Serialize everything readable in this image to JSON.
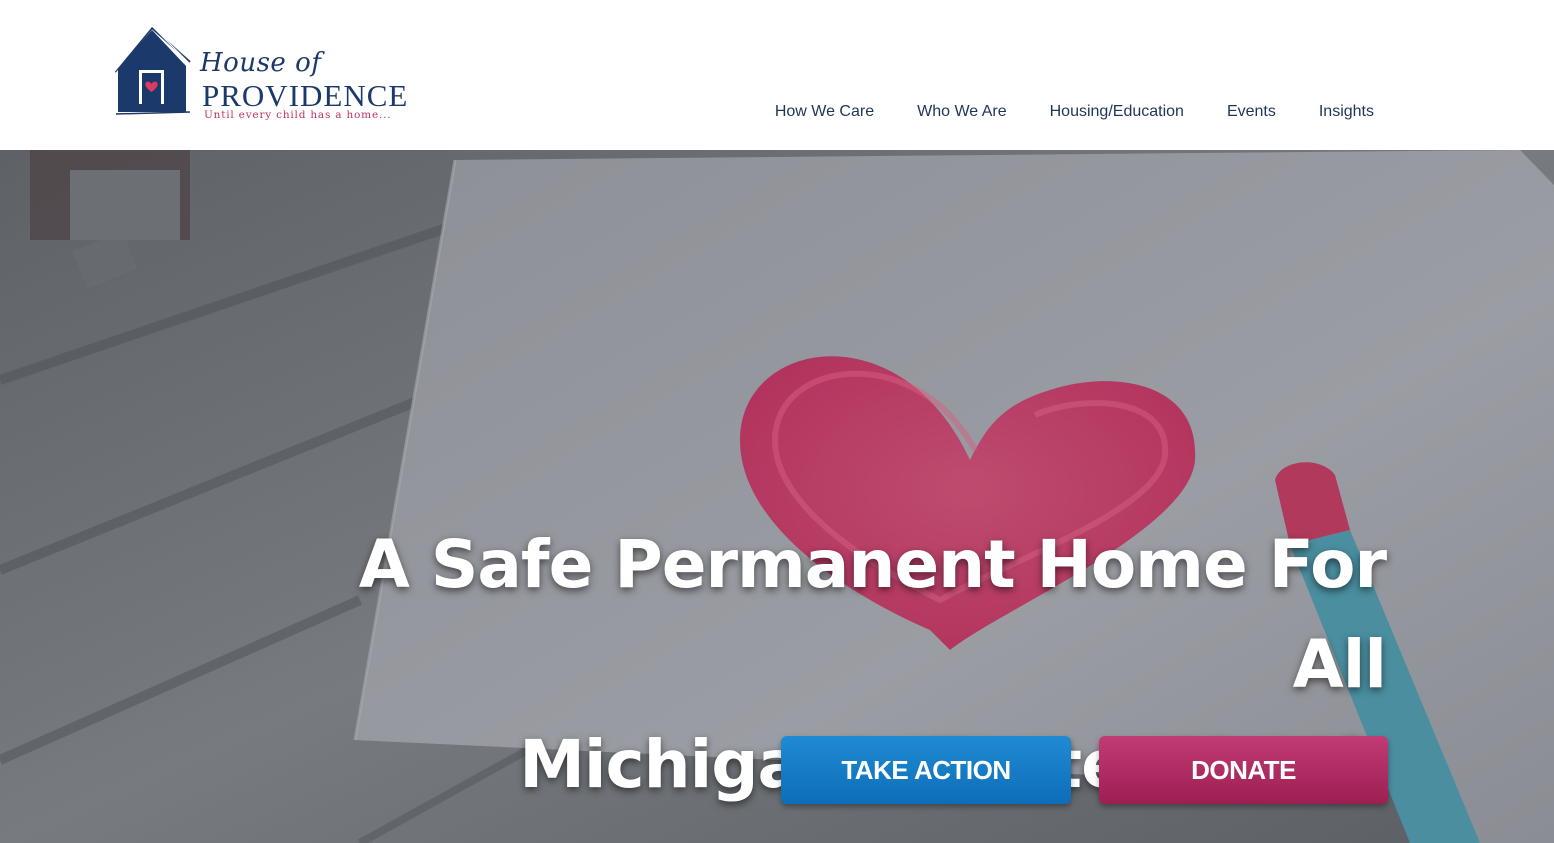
{
  "brand": {
    "script_text": "House of",
    "name": "PROVIDENCE",
    "tagline": "Until every child has a home...",
    "colors": {
      "navy": "#1b3a6b",
      "accent_pink": "#c0335e"
    }
  },
  "nav": {
    "items": [
      {
        "label": "How We Care"
      },
      {
        "label": "Who We Are"
      },
      {
        "label": "Housing/Education"
      },
      {
        "label": "Events"
      },
      {
        "label": "Insights"
      }
    ]
  },
  "hero": {
    "title_line1": "A Safe Permanent Home For All",
    "title_line2": "Michigan's Foster Youth",
    "background_icon": "heart-drawing-image",
    "buttons": {
      "take_action": {
        "label": "TAKE ACTION",
        "color": "#1279c4"
      },
      "donate": {
        "label": "DONATE",
        "color": "#b02c66"
      }
    }
  }
}
